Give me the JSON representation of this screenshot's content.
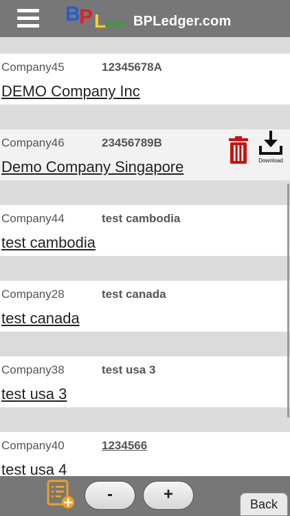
{
  "header": {
    "site_title": "BPLedger.com",
    "logo_text": "BPLedger",
    "menu_icon": "hamburger-menu-icon",
    "background": "#777777"
  },
  "records": [
    {
      "code": "Company45",
      "tax_id": "12345678A",
      "name": "DEMO Company Inc"
    },
    {
      "code": "Company46",
      "tax_id": "23456789B",
      "name": "Demo Company Singapore",
      "selected": true,
      "actions": {
        "delete_icon": "trash-icon",
        "download_label": "Download"
      }
    },
    {
      "code": "Company44",
      "tax_id": "test cambodia",
      "name": "test cambodia"
    },
    {
      "code": "Company28",
      "tax_id": "test canada",
      "name": "test canada"
    },
    {
      "code": "Company38",
      "tax_id": "test usa 3",
      "name": "test usa 3"
    },
    {
      "code": "Company40",
      "tax_id": "1234566",
      "name": "test usa 4"
    }
  ],
  "footer": {
    "add_icon": "add-list-icon",
    "minus_label": "-",
    "plus_label": "+",
    "back_label": "Back"
  },
  "colors": {
    "delete": "#cc1111",
    "add_icon": "#f0a020",
    "separator": "#dcdcdc"
  }
}
